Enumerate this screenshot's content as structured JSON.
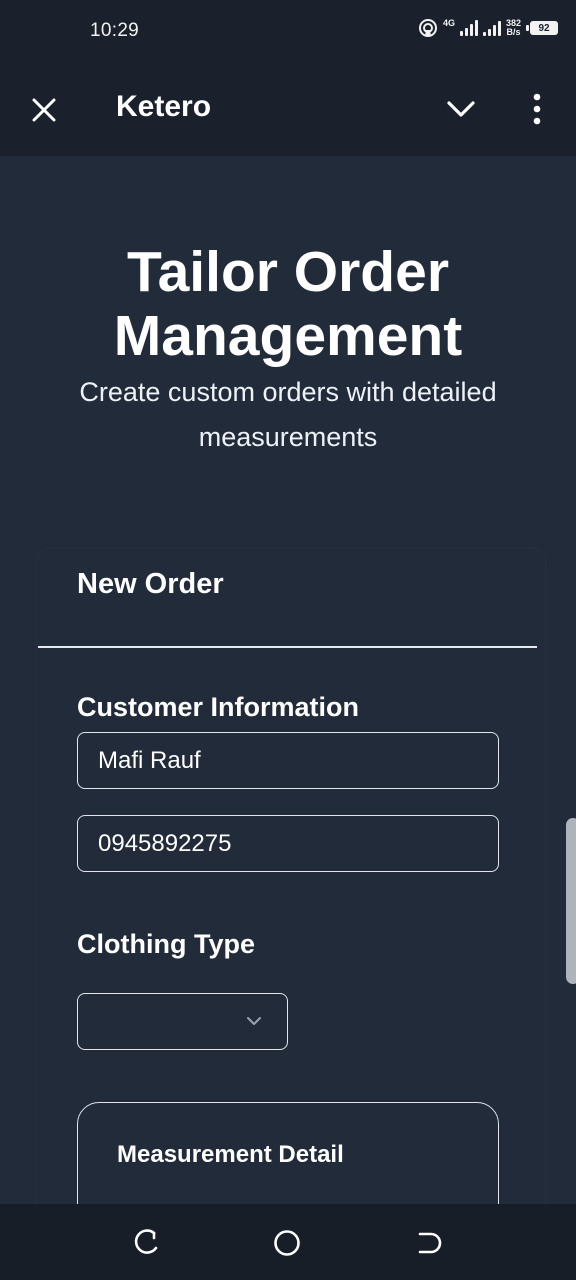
{
  "status_bar": {
    "time": "10:29",
    "network_type": "4G",
    "speed_value": "382",
    "speed_unit": "B/s",
    "battery": "92",
    "icons": [
      "hotspot-icon",
      "signal-icon",
      "signal-icon",
      "battery-icon"
    ]
  },
  "app_bar": {
    "title": "Ketero",
    "icons": [
      "close-icon",
      "chevron-down-icon",
      "more-vertical-icon"
    ]
  },
  "hero": {
    "title": "Tailor Order Management",
    "subtitle": "Create custom orders with detailed measurements"
  },
  "form": {
    "card_title": "New Order",
    "customer_section_label": "Customer Information",
    "customer_name_value": "Mafi Rauf",
    "customer_phone_value": "0945892275",
    "clothing_type_label": "Clothing Type",
    "clothing_type_selected": "",
    "measurement_title": "Measurement Detail"
  },
  "nav_bar": {
    "icons": [
      "back-icon",
      "home-icon",
      "recent-apps-icon"
    ]
  },
  "colors": {
    "background": "#222b3a",
    "app_bar": "#1a212c",
    "border": "#e3e6eb",
    "text": "#ffffff"
  }
}
